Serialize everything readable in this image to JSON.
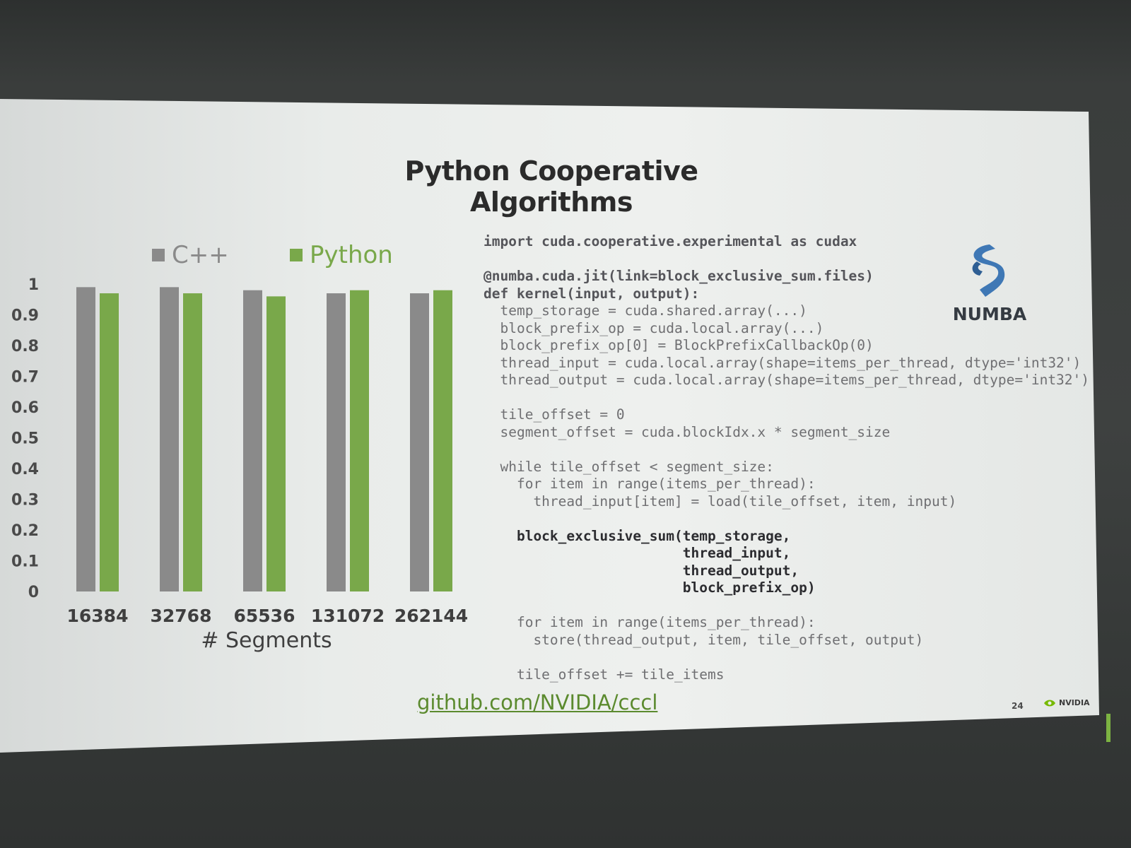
{
  "slide": {
    "title": "Python Cooperative Algorithms",
    "footer_link": "github.com/NVIDIA/cccl",
    "page_number": "24",
    "brand": "NVIDIA",
    "logo_text": "NUMBA"
  },
  "chart_data": {
    "type": "bar",
    "title": "",
    "xlabel": "# Segments",
    "ylabel": "",
    "ylim": [
      0,
      1
    ],
    "yticks": [
      "0",
      "0.1",
      "0.2",
      "0.3",
      "0.4",
      "0.5",
      "0.6",
      "0.7",
      "0.8",
      "0.9",
      "1"
    ],
    "categories": [
      "16384",
      "32768",
      "65536",
      "131072",
      "262144"
    ],
    "legend_placement": "top",
    "grid": false,
    "series": [
      {
        "name": "C++",
        "color": "#8a8a8a",
        "values": [
          0.99,
          0.99,
          0.98,
          0.97,
          0.97
        ]
      },
      {
        "name": "Python",
        "color": "#79a84a",
        "values": [
          0.97,
          0.97,
          0.96,
          0.98,
          0.98
        ]
      }
    ]
  },
  "code": {
    "lines": [
      {
        "text": "import cuda.cooperative.experimental as cudax",
        "style": "first"
      },
      {
        "text": "",
        "style": "normal"
      },
      {
        "text": "@numba.cuda.jit(link=block_exclusive_sum.files)",
        "style": "first"
      },
      {
        "text": "def kernel(input, output):",
        "style": "first"
      },
      {
        "text": "  temp_storage = cuda.shared.array(...)",
        "style": "normal"
      },
      {
        "text": "  block_prefix_op = cuda.local.array(...)",
        "style": "normal"
      },
      {
        "text": "  block_prefix_op[0] = BlockPrefixCallbackOp(0)",
        "style": "normal"
      },
      {
        "text": "  thread_input = cuda.local.array(shape=items_per_thread, dtype='int32')",
        "style": "normal"
      },
      {
        "text": "  thread_output = cuda.local.array(shape=items_per_thread, dtype='int32')",
        "style": "normal"
      },
      {
        "text": "",
        "style": "normal"
      },
      {
        "text": "  tile_offset = 0",
        "style": "normal"
      },
      {
        "text": "  segment_offset = cuda.blockIdx.x * segment_size",
        "style": "normal"
      },
      {
        "text": "",
        "style": "normal"
      },
      {
        "text": "  while tile_offset < segment_size:",
        "style": "normal"
      },
      {
        "text": "    for item in range(items_per_thread):",
        "style": "normal"
      },
      {
        "text": "      thread_input[item] = load(tile_offset, item, input)",
        "style": "normal"
      },
      {
        "text": "",
        "style": "normal"
      },
      {
        "text": "    block_exclusive_sum(temp_storage,",
        "style": "bold"
      },
      {
        "text": "                        thread_input,",
        "style": "bold"
      },
      {
        "text": "                        thread_output,",
        "style": "bold"
      },
      {
        "text": "                        block_prefix_op)",
        "style": "bold"
      },
      {
        "text": "",
        "style": "normal"
      },
      {
        "text": "    for item in range(items_per_thread):",
        "style": "normal"
      },
      {
        "text": "      store(thread_output, item, tile_offset, output)",
        "style": "normal"
      },
      {
        "text": "",
        "style": "normal"
      },
      {
        "text": "    tile_offset += tile_items",
        "style": "normal"
      }
    ]
  }
}
